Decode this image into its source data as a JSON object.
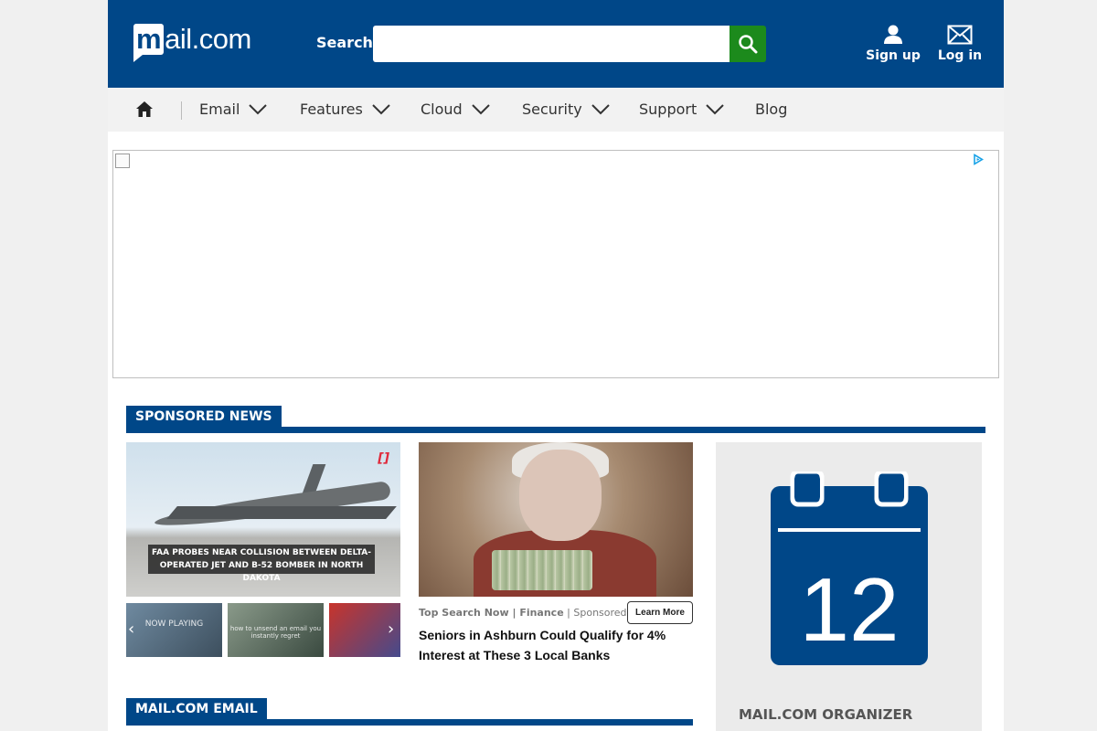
{
  "header": {
    "logo_m": "m",
    "logo_rest": "ail.com",
    "search_label": "Search",
    "search_placeholder": "",
    "signup_label": "Sign up",
    "login_label": "Log in",
    "brand_color": "#004788",
    "search_button_color": "#1c8a1c"
  },
  "nav": {
    "items": [
      {
        "label": "Email"
      },
      {
        "label": "Features"
      },
      {
        "label": "Cloud"
      },
      {
        "label": "Security"
      },
      {
        "label": "Support"
      },
      {
        "label": "Blog"
      }
    ]
  },
  "sponsored": {
    "heading": "SPONSORED NEWS",
    "video": {
      "caption": "FAA PROBES NEAR COLLISION BETWEEN DELTA-OPERATED JET AND B-52 BOMBER IN NORTH DAKOTA",
      "tag": "[]",
      "thumb1_text": "NOW PLAYING",
      "thumb2_text": "how to unsend an email you instantly regret"
    },
    "article": {
      "source": "Top Search Now | Finance",
      "sponsored_label": "Sponsored",
      "cta": "Learn More",
      "headline": "Seniors in Ashburn Could Qualify for 4% Interest at These 3 Local Banks"
    }
  },
  "email_section": {
    "heading": "MAIL.COM EMAIL"
  },
  "organizer": {
    "calendar_day": "12",
    "title": "MAIL.COM ORGANIZER"
  }
}
